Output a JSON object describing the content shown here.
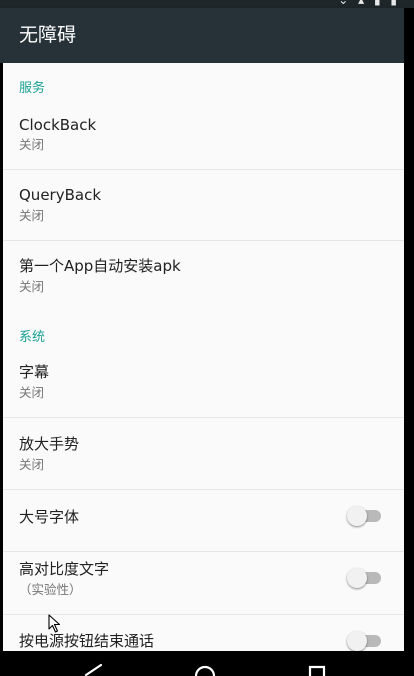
{
  "app_bar": {
    "title": "无障碍"
  },
  "status_bar": {
    "icons": "⌄ ▴ ▮ ▮"
  },
  "sections": {
    "services": {
      "header": "服务",
      "items": [
        {
          "title": "ClockBack",
          "summary": "关闭"
        },
        {
          "title": "QueryBack",
          "summary": "关闭"
        },
        {
          "title": "第一个App自动安装apk",
          "summary": "关闭"
        }
      ]
    },
    "system": {
      "header": "系统",
      "items": [
        {
          "title": "字幕",
          "summary": "关闭"
        },
        {
          "title": "放大手势",
          "summary": "关闭"
        },
        {
          "title": "大号字体",
          "toggle": false
        },
        {
          "title": "高对比度文字",
          "summary": "（实验性）",
          "toggle": false
        },
        {
          "title": "按电源按钮结束通话",
          "toggle": false
        }
      ]
    }
  },
  "nav_bar": {
    "back": "back-icon",
    "home": "home-icon",
    "recents": "recents-icon"
  },
  "colors": {
    "app_bar": "#263238",
    "section_header": "#1aa194",
    "background": "#fafafa",
    "switch_off_track": "#b9b9b9"
  }
}
